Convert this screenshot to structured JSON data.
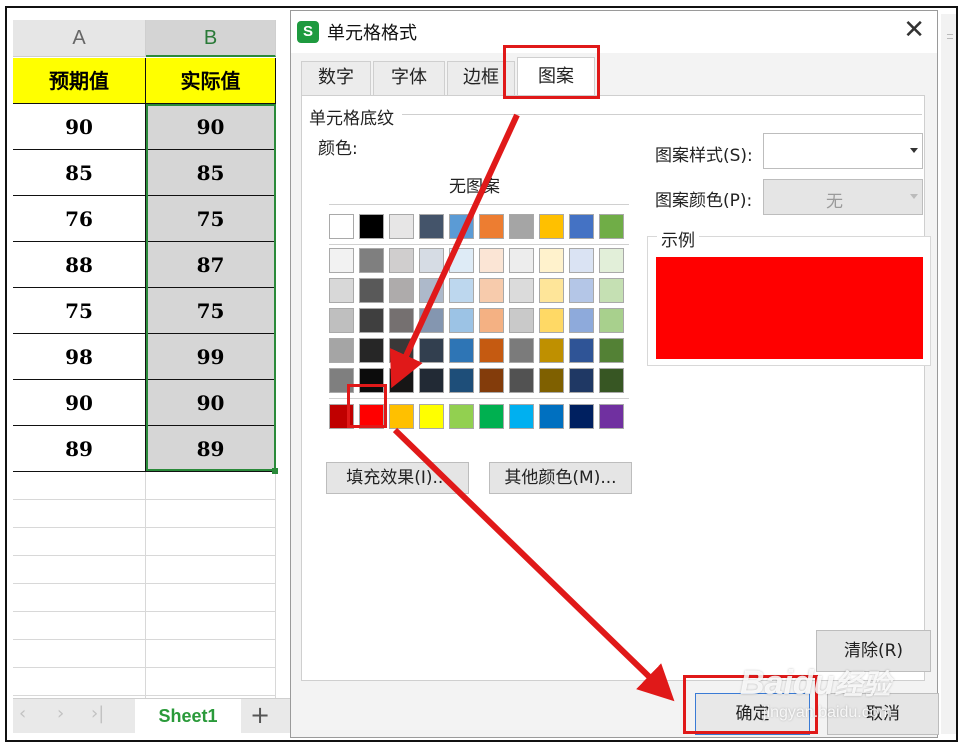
{
  "sheet": {
    "columns": [
      "A",
      "B"
    ],
    "headers": [
      "预期值",
      "实际值"
    ],
    "rows": [
      [
        "90",
        "90"
      ],
      [
        "85",
        "85"
      ],
      [
        "76",
        "75"
      ],
      [
        "88",
        "87"
      ],
      [
        "75",
        "75"
      ],
      [
        "98",
        "99"
      ],
      [
        "90",
        "90"
      ],
      [
        "89",
        "89"
      ]
    ],
    "tab_name": "Sheet1",
    "add_tab": "+",
    "nav": [
      "‹",
      "›",
      "›|"
    ]
  },
  "dialog": {
    "title": "单元格格式",
    "logo": "S",
    "close": "✕",
    "tabs": [
      "数字",
      "字体",
      "边框",
      "图案"
    ],
    "active_tab": "图案",
    "group_title": "单元格底纹",
    "color_label": "颜色:",
    "no_pattern": "无图案",
    "pattern_style_label": "图案样式(S):",
    "pattern_style_value": "",
    "pattern_color_label": "图案颜色(P):",
    "pattern_color_value": "无",
    "sample_label": "示例",
    "fill_effects_button": "填充效果(I)...",
    "more_colors_button": "其他颜色(M)...",
    "clear_button": "清除(R)",
    "ok_button": "确定",
    "cancel_button": "取消",
    "preview_color": "#ff0000",
    "palette_top": [
      "#ffffff",
      "#000000",
      "#e7e6e6",
      "#44546a",
      "#5b9bd5",
      "#ed7d31",
      "#a5a5a5",
      "#ffc000",
      "#4472c4",
      "#70ad47"
    ],
    "palette_tints": [
      [
        "#f2f2f2",
        "#7f7f7f",
        "#d0cece",
        "#d6dce4",
        "#deebf6",
        "#fbe5d5",
        "#ededed",
        "#fff2cc",
        "#dae3f3",
        "#e2efd9"
      ],
      [
        "#d8d8d8",
        "#595959",
        "#aeabab",
        "#adb9ca",
        "#bdd7ee",
        "#f7cbac",
        "#dbdbdb",
        "#fee599",
        "#b4c6e7",
        "#c5e0b3"
      ],
      [
        "#bfbfbf",
        "#3f3f3f",
        "#757070",
        "#8496b0",
        "#9cc3e5",
        "#f4b183",
        "#c9c9c9",
        "#ffd965",
        "#8eaadb",
        "#a8d08d"
      ],
      [
        "#a5a5a5",
        "#262626",
        "#3a3838",
        "#323f4f",
        "#2e75b5",
        "#c55a11",
        "#7b7b7b",
        "#bf9000",
        "#2f5496",
        "#538135"
      ],
      [
        "#7f7f7f",
        "#0c0c0c",
        "#171616",
        "#222a35",
        "#1e4e79",
        "#833c0b",
        "#525252",
        "#7f6000",
        "#1f3864",
        "#375623"
      ]
    ],
    "palette_standard": [
      "#c00000",
      "#ff0000",
      "#ffc000",
      "#ffff00",
      "#92d050",
      "#00b050",
      "#00b0f0",
      "#0070c0",
      "#002060",
      "#7030a0"
    ],
    "selected_color": "#ff0000"
  },
  "watermark": {
    "brand": "Baidu",
    "brand_cn": "经验",
    "url": "jingyan.baidu.com"
  },
  "colors": {
    "header_fill": "#ffff00",
    "selection_green": "#2a8a3a",
    "highlight_red": "#e01919"
  }
}
